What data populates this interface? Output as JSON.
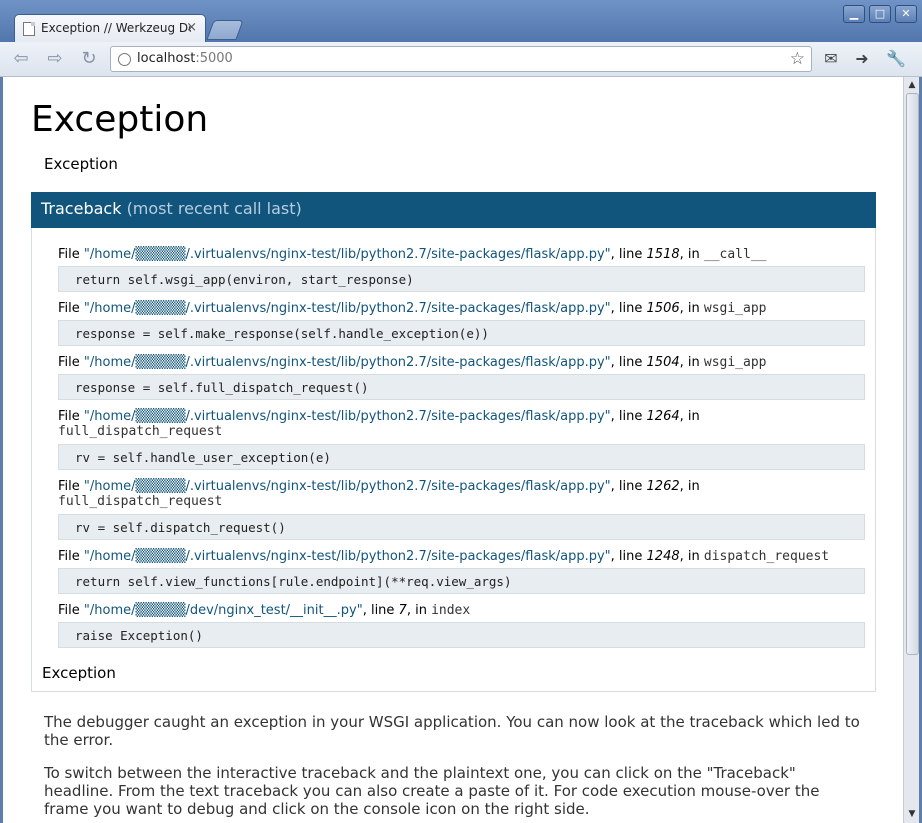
{
  "browser": {
    "tab_title": "Exception // Werkzeug Debugger",
    "tab_close": "×",
    "url_host": "localhost",
    "url_port": ":5000",
    "window_minimize": "▁",
    "window_maximize": "□",
    "window_close": "✕"
  },
  "page": {
    "title": "Exception",
    "subtitle": "Exception",
    "traceback_label": "Traceback",
    "traceback_note": "(most recent call last)",
    "frames": [
      {
        "file": "\"/home/▒▒▒▒▒/.virtualenvs/nginx-test/lib/python2.7/site-packages/flask/app.py\"",
        "line": "1518",
        "func": "__call__",
        "code": "return self.wsgi_app(environ, start_response)"
      },
      {
        "file": "\"/home/▒▒▒▒▒/.virtualenvs/nginx-test/lib/python2.7/site-packages/flask/app.py\"",
        "line": "1506",
        "func": "wsgi_app",
        "code": "response = self.make_response(self.handle_exception(e))"
      },
      {
        "file": "\"/home/▒▒▒▒▒/.virtualenvs/nginx-test/lib/python2.7/site-packages/flask/app.py\"",
        "line": "1504",
        "func": "wsgi_app",
        "code": "response = self.full_dispatch_request()"
      },
      {
        "file": "\"/home/▒▒▒▒▒/.virtualenvs/nginx-test/lib/python2.7/site-packages/flask/app.py\"",
        "line": "1264",
        "func": "full_dispatch_request",
        "code": "rv = self.handle_user_exception(e)"
      },
      {
        "file": "\"/home/▒▒▒▒▒/.virtualenvs/nginx-test/lib/python2.7/site-packages/flask/app.py\"",
        "line": "1262",
        "func": "full_dispatch_request",
        "code": "rv = self.dispatch_request()"
      },
      {
        "file": "\"/home/▒▒▒▒▒/.virtualenvs/nginx-test/lib/python2.7/site-packages/flask/app.py\"",
        "line": "1248",
        "func": "dispatch_request",
        "code": "return self.view_functions[rule.endpoint](**req.view_args)"
      },
      {
        "file": "\"/home/▒▒▒▒▒/dev/nginx_test/__init__.py\"",
        "line": "7",
        "func": "index",
        "code": "raise Exception()"
      }
    ],
    "final_exception": "Exception",
    "explanation_1": "The debugger caught an exception in your WSGI application. You can now look at the traceback which led to the error.",
    "explanation_2": "To switch between the interactive traceback and the plaintext one, you can click on the \"Traceback\" headline. From the text traceback you can also create a paste of it. For code execution mouse-over the frame you want to debug and click on the console icon on the right side."
  },
  "labels": {
    "file": "File ",
    "line": ", line ",
    "in": ", in "
  },
  "colors": {
    "header": "#11557c",
    "code_bg": "#e7edf1",
    "link": "#11557c"
  }
}
